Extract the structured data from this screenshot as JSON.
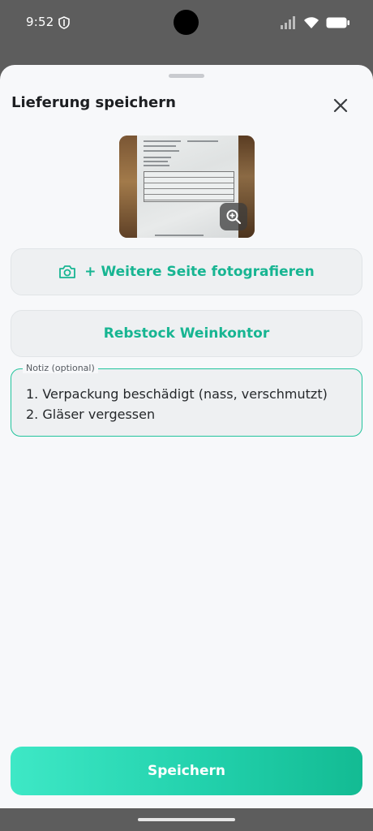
{
  "status_bar": {
    "time": "9:52",
    "icons": [
      "shield-icon",
      "signal-icon",
      "wifi-icon",
      "battery-icon"
    ]
  },
  "sheet": {
    "title": "Lieferung speichern",
    "close_icon": "close-icon"
  },
  "photo": {
    "zoom_icon": "zoom-in-icon"
  },
  "actions": {
    "add_page_label": "+ Weitere Seite fotografieren",
    "add_page_icon": "camera-icon",
    "supplier_label": "Rebstock Weinkontor"
  },
  "note": {
    "label": "Notiz (optional)",
    "value": "1. Verpackung beschädigt (nass, verschmutzt)\n2. Gläser vergessen"
  },
  "save_label": "Speichern",
  "colors": {
    "accent": "#17b592",
    "sheet_background": "#f7f8fa",
    "scrim": "#5d5d5d"
  }
}
